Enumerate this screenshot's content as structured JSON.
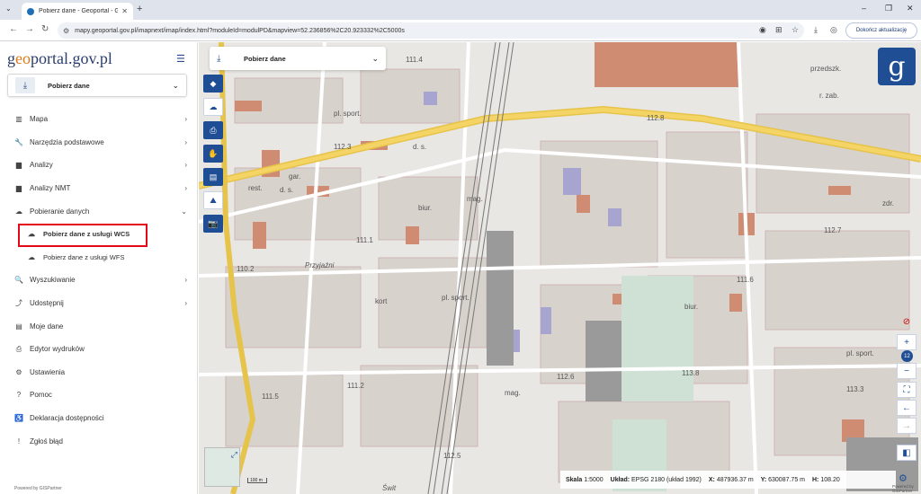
{
  "browser": {
    "tab_title": "Pobierz dane - Geoportal - GU...",
    "url": "mapy.geoportal.gov.pl/imapnext/imap/index.html?moduleId=modulPD&mapview=52.236856%2C20.923332%2C5000s",
    "update_button": "Dokończ aktualizację"
  },
  "sidebar": {
    "logo_g": "g",
    "logo_o": "eo",
    "logo_rest": "portal.gov.pl",
    "module_label": "Pobierz dane",
    "items": [
      {
        "label": "Mapa",
        "icon": "layers-icon",
        "glyph": "▥"
      },
      {
        "label": "Narzędzia podstawowe",
        "icon": "wrench-icon",
        "glyph": "🔧"
      },
      {
        "label": "Analizy",
        "icon": "chart-icon",
        "glyph": "▆"
      },
      {
        "label": "Analizy NMT",
        "icon": "chart-icon",
        "glyph": "▆"
      },
      {
        "label": "Pobieranie danych",
        "icon": "cloud-download-icon",
        "glyph": "☁"
      }
    ],
    "sub_items": [
      {
        "label": "Pobierz dane z usługi WCS"
      },
      {
        "label": "Pobierz dane z usługi WFS"
      }
    ],
    "items2": [
      {
        "label": "Wyszukiwanie",
        "glyph": "🔍"
      },
      {
        "label": "Udostępnij",
        "glyph": "⤴"
      },
      {
        "label": "Moje dane",
        "glyph": "▤"
      },
      {
        "label": "Edytor wydruków",
        "glyph": "⎙"
      },
      {
        "label": "Ustawienia",
        "glyph": "⚙"
      },
      {
        "label": "Pomoc",
        "glyph": "?"
      },
      {
        "label": "Deklaracja dostępności",
        "glyph": "♿"
      },
      {
        "label": "Zgłoś błąd",
        "glyph": "!"
      }
    ],
    "powered": "Powered by GISPartner"
  },
  "map": {
    "top_label": "Pobierz dane",
    "labels": [
      {
        "t": "111.4"
      },
      {
        "t": "pl. sport."
      },
      {
        "t": "112.3"
      },
      {
        "t": "d. s."
      },
      {
        "t": "gar."
      },
      {
        "t": "rest."
      },
      {
        "t": "d. s."
      },
      {
        "t": "Przyjaźni"
      },
      {
        "t": "kort"
      },
      {
        "t": "pl. sport."
      },
      {
        "t": "mag."
      },
      {
        "t": "biur."
      },
      {
        "t": "111.1"
      },
      {
        "t": "110.2"
      },
      {
        "t": "112.8"
      },
      {
        "t": "113.8"
      },
      {
        "t": "przedszk."
      },
      {
        "t": "r. zab."
      },
      {
        "t": "111.2"
      },
      {
        "t": "111.5"
      },
      {
        "t": "112.5"
      },
      {
        "t": "Świt"
      },
      {
        "t": "112.6"
      },
      {
        "t": "111.6"
      },
      {
        "t": "pl. sport."
      },
      {
        "t": "biur."
      },
      {
        "t": "zdr."
      },
      {
        "t": "113.3"
      },
      {
        "t": "mag."
      },
      {
        "t": "112.7"
      }
    ],
    "zoom_level": "12",
    "scale_label": "Skala",
    "scale_value": "1:5000",
    "crs_label": "Układ:",
    "crs_value": "EPSG 2180 (układ 1992)",
    "x_label": "X:",
    "x_value": "487936.37 m",
    "y_label": "Y:",
    "y_value": "630087.75 m",
    "h_label": "H:",
    "h_value": "108.20",
    "scalebar": "100 m",
    "powered": "Powered by GISPartner"
  }
}
